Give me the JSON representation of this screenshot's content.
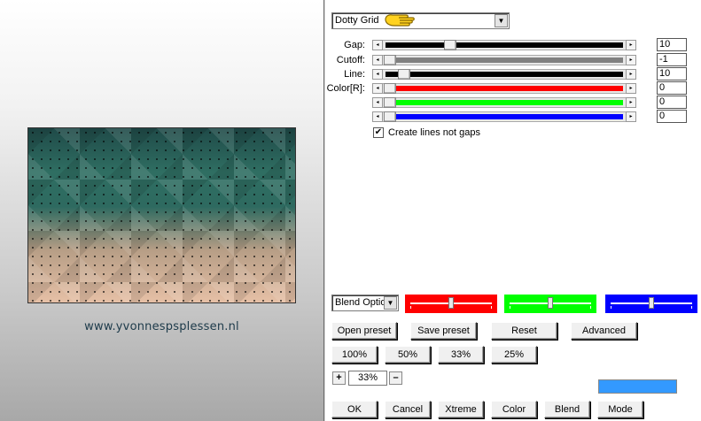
{
  "filter": {
    "selected": "Dotty Grid"
  },
  "sliders": [
    {
      "key": "gap",
      "label": "Gap:",
      "value": "10",
      "color": "#000000",
      "level": 0.26
    },
    {
      "key": "cutoff",
      "label": "Cutoff:",
      "value": "-1",
      "color": "#808080",
      "level": 0.0
    },
    {
      "key": "line",
      "label": "Line:",
      "value": "10",
      "color": "#000000",
      "level": 0.06
    },
    {
      "key": "color-r",
      "label": "Color[R]:",
      "value": "0",
      "color": "#ff0000",
      "level": 0.0
    },
    {
      "key": "color-g",
      "label": "",
      "value": "0",
      "color": "#00ff00",
      "level": 0.0
    },
    {
      "key": "color-b",
      "label": "",
      "value": "0",
      "color": "#0000ff",
      "level": 0.0
    }
  ],
  "checkbox": {
    "label": "Create lines not gaps",
    "checked": true
  },
  "blend": {
    "selected": "Blend Optio"
  },
  "mini_sliders": [
    {
      "key": "red",
      "color": "#ff0000",
      "level": 0.5
    },
    {
      "key": "green",
      "color": "#00ff00",
      "level": 0.5
    },
    {
      "key": "blue",
      "color": "#0000ff",
      "level": 0.5
    }
  ],
  "buttons": {
    "open_preset": "Open preset",
    "save_preset": "Save preset",
    "reset": "Reset",
    "advanced": "Advanced",
    "zoom_100": "100%",
    "zoom_50": "50%",
    "zoom_33": "33%",
    "zoom_25": "25%",
    "ok": "OK",
    "cancel": "Cancel",
    "xtreme": "Xtreme",
    "color": "Color",
    "blend": "Blend",
    "mode": "Mode"
  },
  "zoom": {
    "plus": "+",
    "value": "33%",
    "minus": "–"
  },
  "preview_color": "#3399ff",
  "watermark": "www.yvonnespsplessen.nl"
}
